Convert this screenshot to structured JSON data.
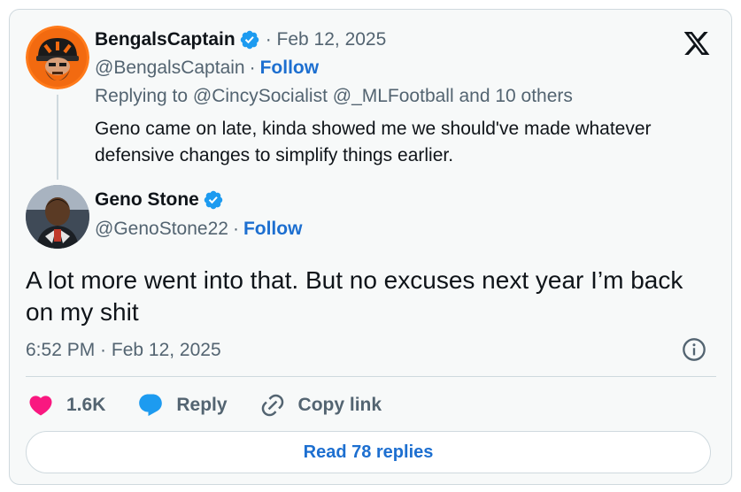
{
  "quoted": {
    "name": "BengalsCaptain",
    "date": "· Feb 12, 2025",
    "handle": "@BengalsCaptain",
    "separator": "·",
    "follow_label": "Follow",
    "replying_to": "Replying to @CincySocialist @_MLFootball and 10 others",
    "text": "Geno came on late, kinda showed me we should've made whatever defensive changes to simplify things earlier."
  },
  "tweet": {
    "name": "Geno Stone",
    "handle": "@GenoStone22",
    "separator": "·",
    "follow_label": "Follow",
    "text": "A lot more went into that. But no excuses next year I’m back on my shit",
    "timestamp": "6:52 PM · Feb 12, 2025"
  },
  "actions": {
    "like_count": "1.6K",
    "reply_label": "Reply",
    "copy_link_label": "Copy link"
  },
  "read_replies_label": "Read 78 replies",
  "icons": {
    "brand": "x-logo-icon",
    "verified": "verified-badge-icon",
    "info": "info-icon",
    "like": "heart-icon",
    "reply": "speech-bubble-icon",
    "copy": "link-icon"
  },
  "colors": {
    "accent": "#1d6fd0",
    "verified": "#1d9bf0",
    "like": "#f91880",
    "muted": "#536471",
    "text": "#0f1419",
    "card_bg": "#f7f9f9",
    "border": "#cfd9de"
  }
}
